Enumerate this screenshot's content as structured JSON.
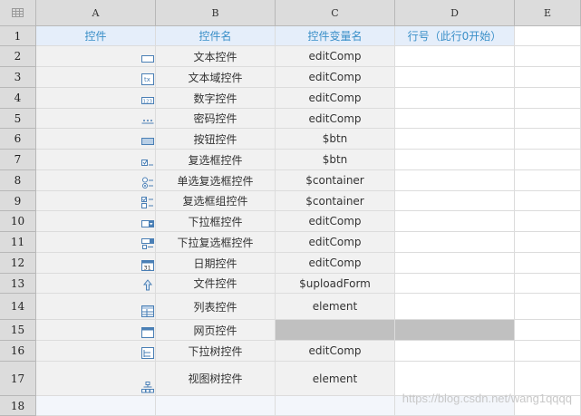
{
  "columns": [
    "A",
    "B",
    "C",
    "D",
    "E"
  ],
  "header_row": {
    "row_number": "1",
    "cells": [
      "控件",
      "控件名",
      "控件变量名",
      "行号（此行0开始）",
      ""
    ]
  },
  "rows": [
    {
      "row_number": "2",
      "icon": "text-field-icon",
      "name": "文本控件",
      "var": "editComp"
    },
    {
      "row_number": "3",
      "icon": "textarea-icon",
      "name": "文本域控件",
      "var": "editComp"
    },
    {
      "row_number": "4",
      "icon": "number-field-icon",
      "name": "数字控件",
      "var": "editComp"
    },
    {
      "row_number": "5",
      "icon": "password-field-icon",
      "name": "密码控件",
      "var": "editComp"
    },
    {
      "row_number": "6",
      "icon": "button-control-icon",
      "name": "按钮控件",
      "var": "$btn"
    },
    {
      "row_number": "7",
      "icon": "checkbox-icon",
      "name": "复选框控件",
      "var": "$btn"
    },
    {
      "row_number": "8",
      "icon": "radio-group-icon",
      "name": "单选复选框控件",
      "var": "$container"
    },
    {
      "row_number": "9",
      "icon": "checkbox-group-icon",
      "name": "复选框组控件",
      "var": "$container"
    },
    {
      "row_number": "10",
      "icon": "dropdown-icon",
      "name": "下拉框控件",
      "var": "editComp"
    },
    {
      "row_number": "11",
      "icon": "dropdown-checkbox-icon",
      "name": "下拉复选框控件",
      "var": "editComp"
    },
    {
      "row_number": "12",
      "icon": "calendar-icon",
      "name": "日期控件",
      "var": "editComp",
      "icon_text": "31"
    },
    {
      "row_number": "13",
      "icon": "upload-icon",
      "name": "文件控件",
      "var": "$uploadForm"
    },
    {
      "row_number": "14",
      "icon": "list-icon",
      "name": "列表控件",
      "var": "element"
    },
    {
      "row_number": "15",
      "icon": "webpage-icon",
      "name": "网页控件",
      "var": "",
      "shaded": true
    },
    {
      "row_number": "16",
      "icon": "dropdown-tree-icon",
      "name": "下拉树控件",
      "var": "editComp"
    },
    {
      "row_number": "17",
      "icon": "tree-view-icon",
      "name": "视图树控件",
      "var": "element"
    }
  ],
  "last_row": {
    "row_number": "18"
  },
  "watermark": "https://blog.csdn.net/wang1qqqq"
}
